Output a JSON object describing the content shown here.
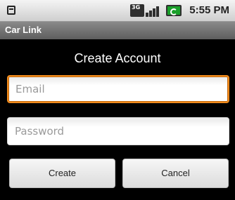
{
  "status_bar": {
    "network_label": "3G",
    "time": "5:55 PM",
    "icons": [
      "notification-icon",
      "network-3g-icon",
      "signal-icon",
      "battery-charging-icon"
    ]
  },
  "app": {
    "title": "Car Link"
  },
  "form": {
    "heading": "Create Account",
    "email_placeholder": "Email",
    "email_value": "",
    "password_placeholder": "Password",
    "password_value": "",
    "create_label": "Create",
    "cancel_label": "Cancel"
  },
  "colors": {
    "focus_border": "#f08a1c",
    "battery": "#1aa02a",
    "title_bar": "#6e6e6e"
  }
}
